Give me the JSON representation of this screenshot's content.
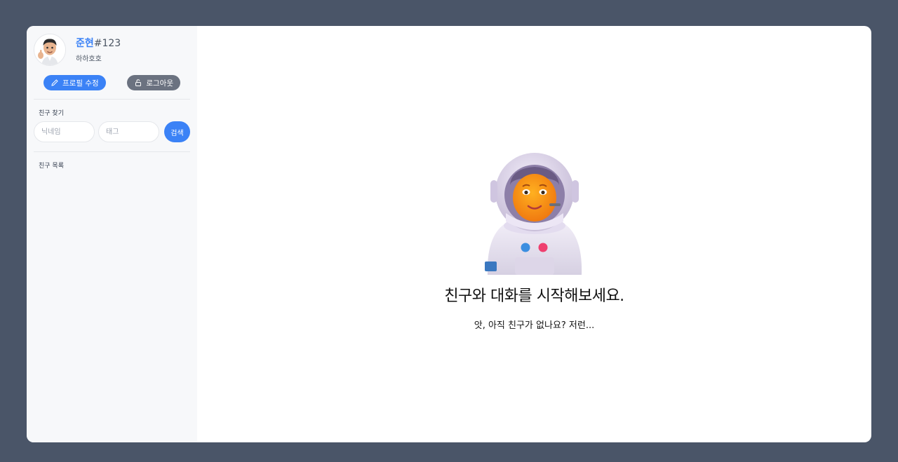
{
  "profile": {
    "nickname": "준현",
    "tag": "#123",
    "status": "하하호호",
    "avatar_icon": "memoji-avatar"
  },
  "buttons": {
    "edit_profile": "프로필 수정",
    "logout": "로그아웃",
    "edit_icon": "pencil-icon",
    "logout_icon": "unlock-icon"
  },
  "find_friends": {
    "label": "친구 찾기",
    "nickname_placeholder": "닉네임",
    "tag_placeholder": "태그",
    "search_label": "검색"
  },
  "friend_list": {
    "label": "친구 목록"
  },
  "empty_state": {
    "illustration": "astronaut-icon",
    "title": "친구와 대화를 시작해보세요.",
    "subtitle": "앗, 아직 친구가 없나요? 저런..."
  },
  "colors": {
    "page_background": "#4a5568",
    "accent": "#3b82f6",
    "secondary_button": "#6b7280",
    "sidebar_background": "#f7f8fa"
  }
}
